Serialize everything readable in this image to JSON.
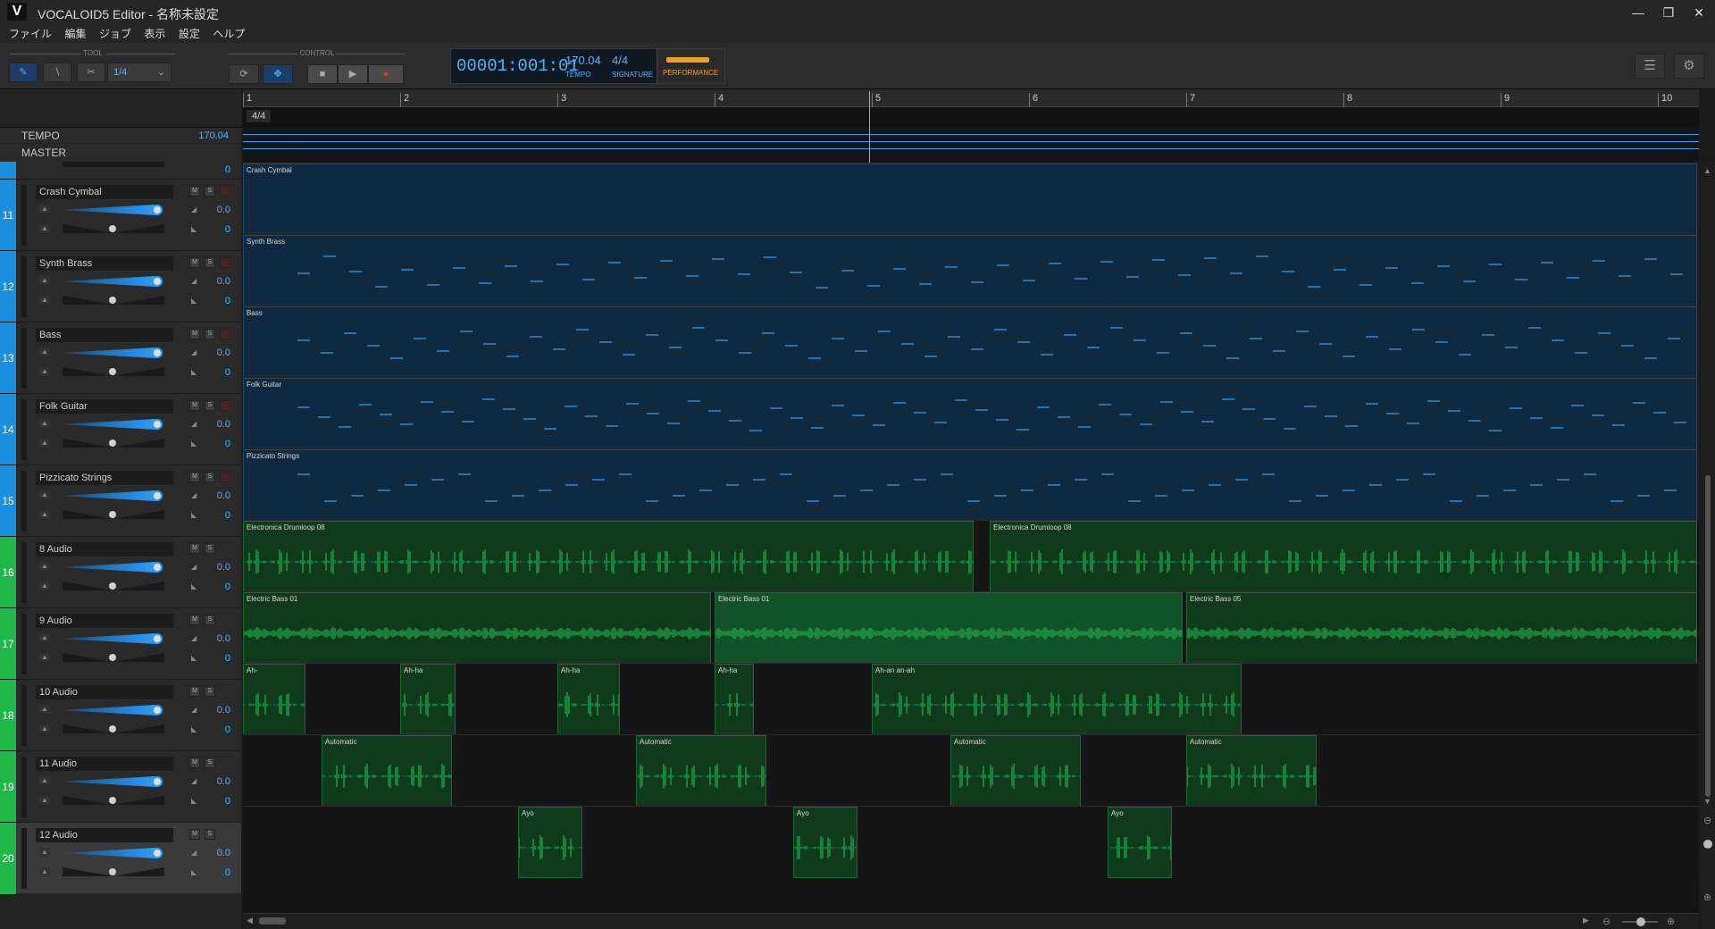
{
  "window": {
    "title": "VOCALOID5 Editor - 名称未設定",
    "logo": "V"
  },
  "menu": [
    "ファイル",
    "編集",
    "ジョブ",
    "表示",
    "設定",
    "ヘルプ"
  ],
  "toolbar": {
    "tool_label": "TOOL",
    "control_label": "CONTROL",
    "quantize": "1/4",
    "tools": [
      "pencil-icon",
      "line-icon",
      "scissors-icon"
    ]
  },
  "display": {
    "timecode": "00001:001:01",
    "tempo": "170.04",
    "tempo_label": "TEMPO",
    "signature": "4/4",
    "signature_label": "SIGNATURE",
    "performance_label": "PERFORMANCE"
  },
  "header_rows": {
    "tempo_name": "TEMPO",
    "tempo_value": "170.04",
    "master_name": "MASTER"
  },
  "ruler": {
    "bars": [
      "1",
      "2",
      "3",
      "4",
      "5",
      "6",
      "7",
      "8",
      "9",
      "10"
    ],
    "time_signature": "4/4"
  },
  "colors": {
    "midi_accent": "#1a8fe0",
    "audio_accent": "#1fb64a",
    "highlight": "#4ab6ff",
    "playhead": "#f0a020"
  },
  "tracks": [
    {
      "number": "11",
      "name": "Crash Cymbal",
      "type": "midi",
      "volume": "0.0",
      "pan": "0"
    },
    {
      "number": "12",
      "name": "Synth Brass",
      "type": "midi",
      "volume": "0.0",
      "pan": "0"
    },
    {
      "number": "13",
      "name": "Bass",
      "type": "midi",
      "volume": "0.0",
      "pan": "0"
    },
    {
      "number": "14",
      "name": "Folk Guitar",
      "type": "midi",
      "volume": "0.0",
      "pan": "0"
    },
    {
      "number": "15",
      "name": "Pizzicato Strings",
      "type": "midi",
      "volume": "0.0",
      "pan": "0"
    },
    {
      "number": "16",
      "name": "8 Audio",
      "type": "audio",
      "volume": "0.0",
      "pan": "0"
    },
    {
      "number": "17",
      "name": "9 Audio",
      "type": "audio",
      "volume": "0.0",
      "pan": "0"
    },
    {
      "number": "18",
      "name": "10 Audio",
      "type": "audio",
      "volume": "0.0",
      "pan": "0"
    },
    {
      "number": "19",
      "name": "11 Audio",
      "type": "audio",
      "volume": "0.0",
      "pan": "0"
    },
    {
      "number": "20",
      "name": "12 Audio",
      "type": "audio",
      "volume": "0.0",
      "pan": "0",
      "selected": true
    }
  ],
  "partial_track": {
    "volume": "0"
  },
  "ms_labels": {
    "mute": "M",
    "solo": "S"
  },
  "lanes": [
    {
      "clips": [
        {
          "label": "Crash Cymbal",
          "start_bar": 1.0,
          "end_bar": 10.25
        }
      ]
    },
    {
      "clips": [
        {
          "label": "Synth Brass",
          "start_bar": 1.0,
          "end_bar": 10.25
        }
      ]
    },
    {
      "clips": [
        {
          "label": "Bass",
          "start_bar": 1.0,
          "end_bar": 10.25
        }
      ]
    },
    {
      "clips": [
        {
          "label": "Folk Guitar",
          "start_bar": 1.0,
          "end_bar": 10.25
        }
      ]
    },
    {
      "clips": [
        {
          "label": "Pizzicato Strings",
          "start_bar": 1.0,
          "end_bar": 10.25
        }
      ]
    },
    {
      "clips": [
        {
          "label": "Electronica Drumloop 08",
          "start_bar": 1.0,
          "end_bar": 5.65
        },
        {
          "label": "Electronica Drumloop 08",
          "start_bar": 5.75,
          "end_bar": 10.25
        }
      ]
    },
    {
      "clips": [
        {
          "label": "Electric Bass 01",
          "start_bar": 1.0,
          "end_bar": 3.98
        },
        {
          "label": "Electric Bass 01",
          "start_bar": 4.0,
          "end_bar": 6.98
        },
        {
          "label": "Electric Bass 05",
          "start_bar": 7.0,
          "end_bar": 10.25
        }
      ]
    },
    {
      "clips": [
        {
          "label": "Ah-",
          "start_bar": 1.0,
          "end_bar": 1.4
        },
        {
          "label": "Ah-ha",
          "start_bar": 2.0,
          "end_bar": 2.35
        },
        {
          "label": "Ah-ha",
          "start_bar": 3.0,
          "end_bar": 3.4
        },
        {
          "label": "Ah-ha",
          "start_bar": 4.0,
          "end_bar": 4.25
        },
        {
          "label": "Ah-an an-ah",
          "start_bar": 5.0,
          "end_bar": 7.35
        }
      ]
    },
    {
      "clips": [
        {
          "label": "Automatic",
          "start_bar": 1.5,
          "end_bar": 2.33
        },
        {
          "label": "Automatic",
          "start_bar": 3.5,
          "end_bar": 4.33
        },
        {
          "label": "Automatic",
          "start_bar": 5.5,
          "end_bar": 6.33
        },
        {
          "label": "Automatic",
          "start_bar": 7.0,
          "end_bar": 7.83
        }
      ]
    },
    {
      "clips": [
        {
          "label": "Ayo",
          "start_bar": 2.75,
          "end_bar": 3.16
        },
        {
          "label": "Ayo",
          "start_bar": 4.5,
          "end_bar": 4.91
        },
        {
          "label": "Ayo",
          "start_bar": 6.5,
          "end_bar": 6.91
        }
      ]
    }
  ]
}
